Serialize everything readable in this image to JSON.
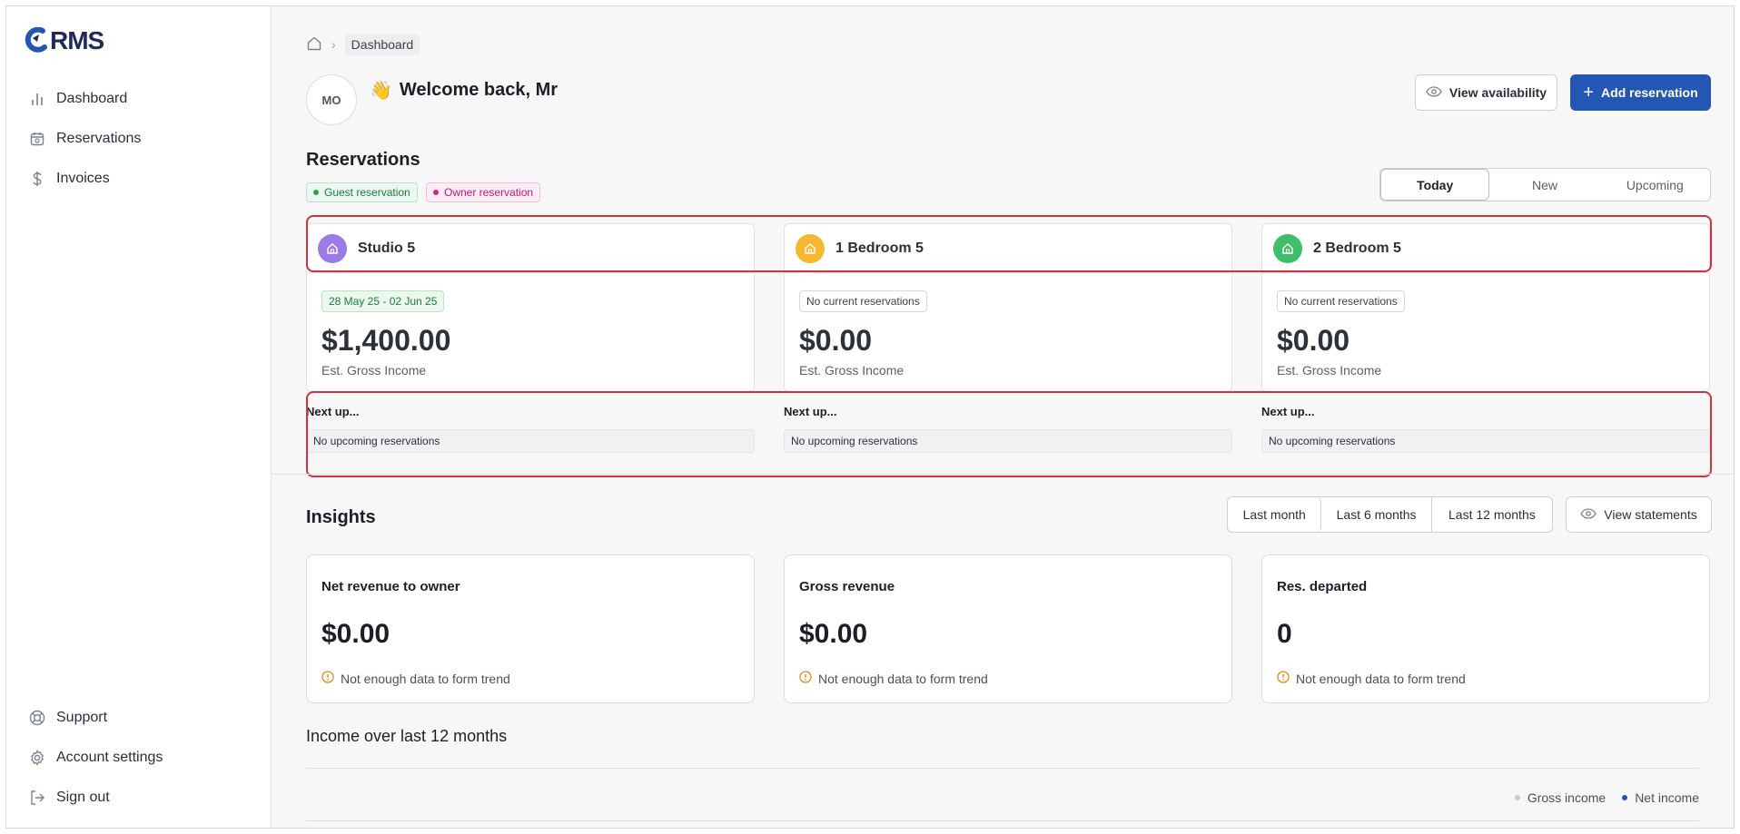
{
  "brand": {
    "logo_text": "RMS"
  },
  "sidebar": {
    "items": [
      {
        "label": "Dashboard",
        "icon": "bar-chart-icon"
      },
      {
        "label": "Reservations",
        "icon": "calendar-icon"
      },
      {
        "label": "Invoices",
        "icon": "dollar-icon"
      }
    ],
    "bottom": [
      {
        "label": "Support",
        "icon": "lifebuoy-icon"
      },
      {
        "label": "Account settings",
        "icon": "gear-icon"
      },
      {
        "label": "Sign out",
        "icon": "sign-out-icon"
      }
    ]
  },
  "breadcrumb": {
    "current": "Dashboard"
  },
  "header": {
    "avatar_initials": "MO",
    "welcome": "Welcome back, Mr",
    "wave": "👋",
    "view_availability": "View availability",
    "add_reservation": "Add reservation"
  },
  "reservations": {
    "title": "Reservations",
    "legend_guest": "Guest reservation",
    "legend_owner": "Owner reservation",
    "filters": [
      "Today",
      "New",
      "Upcoming"
    ],
    "active_filter": "Today",
    "units": [
      {
        "name": "Studio 5",
        "icon_color": "#9b7be6",
        "tag": "28 May 25 - 02 Jun 25",
        "amount": "$1,400.00",
        "sub": "Est. Gross Income",
        "next_label": "Next up...",
        "next_text": "No upcoming reservations"
      },
      {
        "name": "1 Bedroom 5",
        "icon_color": "#f5b82e",
        "tag": "No current reservations",
        "amount": "$0.00",
        "sub": "Est. Gross Income",
        "next_label": "Next up...",
        "next_text": "No upcoming reservations"
      },
      {
        "name": "2 Bedroom 5",
        "icon_color": "#3fbf6c",
        "tag": "No current reservations",
        "amount": "$0.00",
        "sub": "Est. Gross Income",
        "next_label": "Next up...",
        "next_text": "No upcoming reservations"
      }
    ]
  },
  "insights": {
    "title": "Insights",
    "ranges": [
      "Last month",
      "Last 6 months",
      "Last 12 months"
    ],
    "active_range": "Last month",
    "view_statements": "View statements",
    "cards": [
      {
        "title": "Net revenue to owner",
        "value": "$0.00",
        "note": "Not enough data to form trend"
      },
      {
        "title": "Gross revenue",
        "value": "$0.00",
        "note": "Not enough data to form trend"
      },
      {
        "title": "Res. departed",
        "value": "0",
        "note": "Not enough data to form trend"
      }
    ]
  },
  "income_chart": {
    "title": "Income over last 12 months",
    "legend": [
      {
        "name": "Gross income",
        "color": "#c9cbd1"
      },
      {
        "name": "Net income",
        "color": "#2456b3"
      }
    ]
  },
  "colors": {
    "primary": "#2456b3",
    "highlight": "#d3313f"
  }
}
